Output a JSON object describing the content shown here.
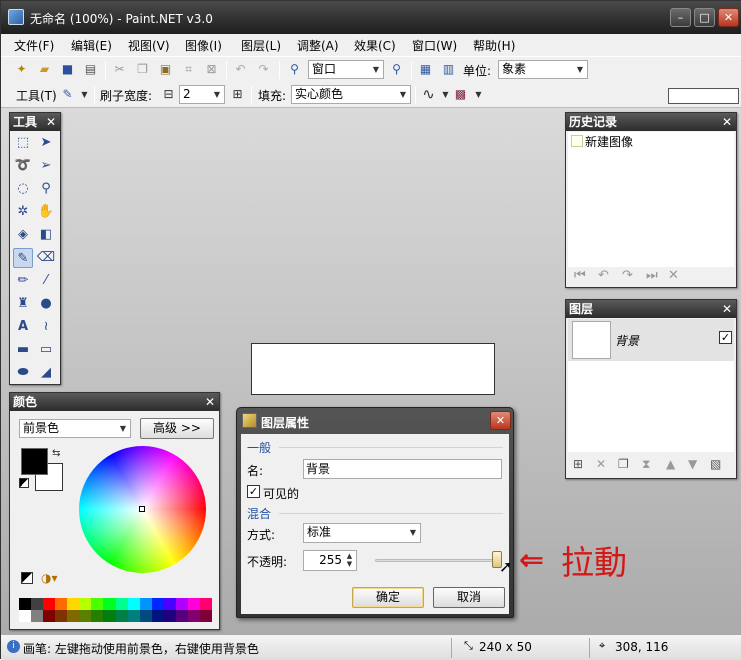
{
  "window": {
    "title": "无命名 (100%) - Paint.NET v3.0",
    "min": "–",
    "max": "□",
    "close": "✕"
  },
  "menu": [
    "文件(F)",
    "编辑(E)",
    "视图(V)",
    "图像(I)",
    "图层(L)",
    "调整(A)",
    "效果(C)",
    "窗口(W)",
    "帮助(H)"
  ],
  "toolbar1": {
    "zoom_value": "窗口",
    "units_label": "单位:",
    "units_value": "象素"
  },
  "toolbar2": {
    "tool_label": "工具(T)",
    "brush_width_label": "刷子宽度:",
    "brush_width_minus": "⊟",
    "brush_width_value": "2",
    "brush_width_plus": "⊞",
    "fill_label": "填充:",
    "fill_value": "实心颜色"
  },
  "tools_panel": {
    "title": "工具",
    "close": "✕"
  },
  "colors_panel": {
    "title": "颜色",
    "close": "✕",
    "target": "前景色",
    "advanced_button": "高级 >>",
    "accent_primary": "#000000",
    "accent_secondary": "#ffffff"
  },
  "palette": [
    "#000000",
    "#404040",
    "#ff0000",
    "#ff6a00",
    "#ffd800",
    "#b6ff00",
    "#4cff00",
    "#00ff21",
    "#00ff90",
    "#00ffff",
    "#0094ff",
    "#0026ff",
    "#4800ff",
    "#b200ff",
    "#ff00dc",
    "#ff006e",
    "#ffffff",
    "#808080",
    "#7f0000",
    "#7f3300",
    "#7f6a00",
    "#5b7f00",
    "#267f00",
    "#007f0e",
    "#007f46",
    "#007f7f",
    "#004a7f",
    "#00137f",
    "#21007f",
    "#57007f",
    "#7f006e",
    "#7f0037"
  ],
  "history_panel": {
    "title": "历史记录",
    "close": "✕",
    "items": [
      "新建图像"
    ]
  },
  "layers_panel": {
    "title": "图层",
    "close": "✕",
    "layer_name": "背景",
    "visible": "✓"
  },
  "dialog": {
    "title": "图层属性",
    "close": "✕",
    "section_general": "一般",
    "name_label": "名:",
    "name_value": "背景",
    "visible_label": "可见的",
    "visible_check": "✓",
    "section_blend": "混合",
    "blend_label": "方式:",
    "blend_value": "标准",
    "opacity_label": "不透明:",
    "opacity_value": "255",
    "opacity_fraction": 1.0,
    "ok": "确定",
    "cancel": "取消"
  },
  "annotation": {
    "arrow": "⇐",
    "text": "拉動",
    "color": "#d41818"
  },
  "statusbar": {
    "info_icon": "i",
    "text": "画笔: 左键拖动使用前景色，右键使用背景色",
    "selection_size": "240 x 50",
    "cursor_pos": "308, 116"
  }
}
